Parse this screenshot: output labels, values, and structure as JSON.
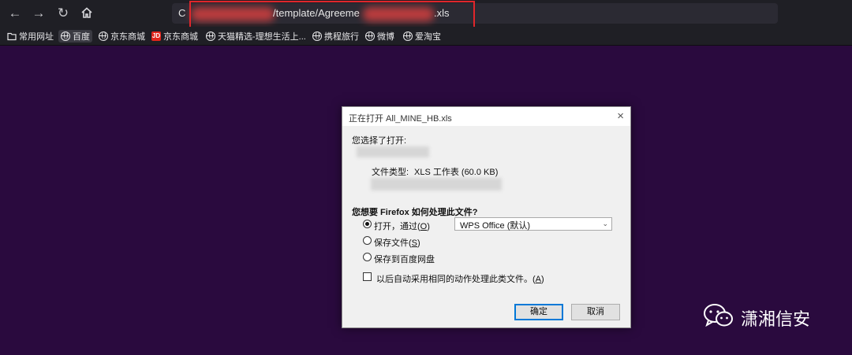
{
  "browser": {
    "url_lead": "C",
    "url_visible": "/template/Agreeme",
    "url_suffix": ".xls",
    "bookmarks": [
      {
        "label": "常用网址",
        "icon": "folder-icon"
      },
      {
        "label": "百度",
        "icon": "globe-icon"
      },
      {
        "label": "京东商城",
        "icon": "globe-icon"
      },
      {
        "label": "京东商城",
        "icon": "jd-icon",
        "icon_text": "JD"
      },
      {
        "label": "天猫精选-理想生活上...",
        "icon": "globe-icon"
      },
      {
        "label": "携程旅行",
        "icon": "globe-icon"
      },
      {
        "label": "微博",
        "icon": "globe-icon"
      },
      {
        "label": "爱淘宝",
        "icon": "globe-icon"
      }
    ]
  },
  "dialog": {
    "title": "正在打开 All_MINE_HB.xls",
    "close_glyph": "×",
    "chose_to_open": "您选择了打开:",
    "file_type_label": "文件类型:",
    "file_type_value": "XLS 工作表 (60.0 KB)",
    "question": "您想要 Firefox 如何处理此文件?",
    "open_with_label": "打开，通过",
    "open_with_key": "O",
    "open_with_app": "WPS Office (默认)",
    "save_file_label": "保存文件",
    "save_file_key": "S",
    "save_baidu_label": "保存到百度网盘",
    "auto_label": "以后自动采用相同的动作处理此类文件。",
    "auto_key": "A",
    "ok_label": "确定",
    "cancel_label": "取消"
  },
  "watermark": {
    "text": "潇湘信安"
  },
  "colors": {
    "page_background": "#2a0a3e",
    "toolbar": "#1f1f25",
    "highlight": "#e0262b",
    "default_button_border": "#0078d7"
  }
}
